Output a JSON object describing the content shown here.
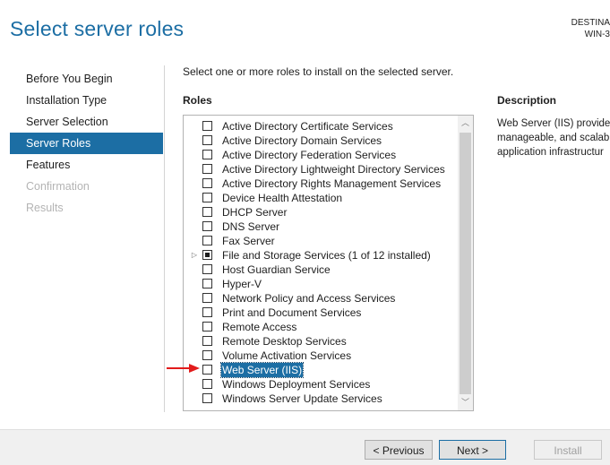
{
  "header": {
    "title": "Select server roles",
    "destination_line1": "DESTINA",
    "destination_line2": "WIN-3"
  },
  "nav": {
    "items": [
      {
        "label": "Before You Begin",
        "state": "normal"
      },
      {
        "label": "Installation Type",
        "state": "normal"
      },
      {
        "label": "Server Selection",
        "state": "normal"
      },
      {
        "label": "Server Roles",
        "state": "active"
      },
      {
        "label": "Features",
        "state": "normal"
      },
      {
        "label": "Confirmation",
        "state": "disabled"
      },
      {
        "label": "Results",
        "state": "disabled"
      }
    ]
  },
  "main": {
    "intro": "Select one or more roles to install on the selected server.",
    "roles_heading": "Roles",
    "description_heading": "Description",
    "description_lines": [
      "Web Server (IIS) provide",
      "manageable, and scalab",
      "application infrastructur"
    ]
  },
  "roles": [
    {
      "label": "Active Directory Certificate Services",
      "state": "unchecked"
    },
    {
      "label": "Active Directory Domain Services",
      "state": "unchecked"
    },
    {
      "label": "Active Directory Federation Services",
      "state": "unchecked"
    },
    {
      "label": "Active Directory Lightweight Directory Services",
      "state": "unchecked"
    },
    {
      "label": "Active Directory Rights Management Services",
      "state": "unchecked"
    },
    {
      "label": "Device Health Attestation",
      "state": "unchecked"
    },
    {
      "label": "DHCP Server",
      "state": "unchecked"
    },
    {
      "label": "DNS Server",
      "state": "unchecked"
    },
    {
      "label": "Fax Server",
      "state": "unchecked"
    },
    {
      "label": "File and Storage Services (1 of 12 installed)",
      "state": "partial",
      "expandable": true
    },
    {
      "label": "Host Guardian Service",
      "state": "unchecked"
    },
    {
      "label": "Hyper-V",
      "state": "unchecked"
    },
    {
      "label": "Network Policy and Access Services",
      "state": "unchecked"
    },
    {
      "label": "Print and Document Services",
      "state": "unchecked"
    },
    {
      "label": "Remote Access",
      "state": "unchecked"
    },
    {
      "label": "Remote Desktop Services",
      "state": "unchecked"
    },
    {
      "label": "Volume Activation Services",
      "state": "unchecked"
    },
    {
      "label": "Web Server (IIS)",
      "state": "unchecked",
      "selected": true
    },
    {
      "label": "Windows Deployment Services",
      "state": "unchecked"
    },
    {
      "label": "Windows Server Update Services",
      "state": "unchecked"
    }
  ],
  "scrollbar": {
    "up_icon": "chevron-up-icon",
    "down_icon": "chevron-down-icon"
  },
  "footer": {
    "previous_label": "< Previous",
    "next_label": "Next >",
    "install_label": "Install"
  },
  "colors": {
    "accent": "#1c6ea4",
    "annotation_arrow": "#e21b1b"
  }
}
